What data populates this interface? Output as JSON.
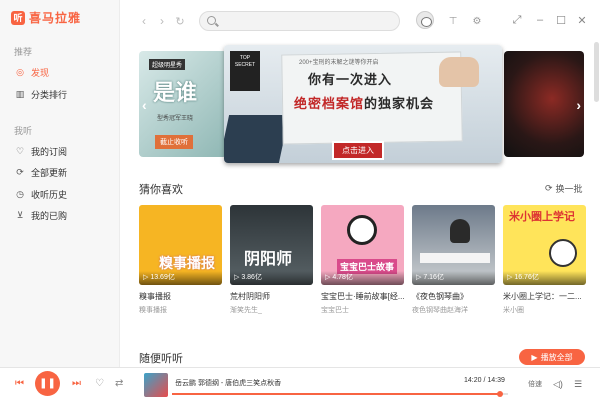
{
  "app": {
    "logo_mark": "听",
    "logo_text": "喜马拉雅"
  },
  "sidebar": {
    "section1_title": "推荐",
    "section2_title": "我听",
    "items": [
      {
        "label": "发现",
        "icon": "compass-icon",
        "active": true
      },
      {
        "label": "分类排行",
        "icon": "ranking-icon",
        "active": false
      },
      {
        "label": "我的订阅",
        "icon": "heart-icon",
        "active": false
      },
      {
        "label": "全部更新",
        "icon": "refresh-circle-icon",
        "active": false
      },
      {
        "label": "收听历史",
        "icon": "clock-icon",
        "active": false
      },
      {
        "label": "我的已购",
        "icon": "cart-icon",
        "active": false
      }
    ]
  },
  "topbar": {
    "search_placeholder": ""
  },
  "banner": {
    "left": {
      "tag": "超级明星秀",
      "title": "是谁",
      "subtitle": "型秀冠军王晓",
      "button": "截止收听"
    },
    "main": {
      "top_text": "200+宝刑的末解之谜等你开启",
      "line1": "你有一次进入",
      "line2_red": "绝密档案馆",
      "line2_rest": "的独家机会",
      "cta": "点击进入"
    }
  },
  "guess": {
    "title": "猜你喜欢",
    "refresh_label": "换一批",
    "cards": [
      {
        "title": "糗事播报",
        "sub": "糗事播报",
        "plays": "13.69亿",
        "cover_text": "糗事播报"
      },
      {
        "title": "荒村阴阳师",
        "sub": "渐笑先生_",
        "plays": "3.86亿",
        "cover_text": "阴阳师"
      },
      {
        "title": "宝宝巴士·睡前故事[经...",
        "sub": "宝宝巴士",
        "plays": "4.78亿",
        "cover_text": "宝宝巴士故事"
      },
      {
        "title": "《夜色钢琴曲》",
        "sub": "夜色钢琴曲赵海洋",
        "plays": "7.16亿",
        "cover_text": ""
      },
      {
        "title": "米小圈上学记：一二...",
        "sub": "米小圈",
        "plays": "16.76亿",
        "cover_text": "米小圈上学记"
      }
    ]
  },
  "random": {
    "title": "随便听听",
    "play_all": "播放全部"
  },
  "player": {
    "title": "岳云鹏 郭德纲 - 唐伯虎三笑点秋香",
    "current": "14:20",
    "total": "14:39",
    "progress": 0.976,
    "speed_label": "倍速"
  }
}
